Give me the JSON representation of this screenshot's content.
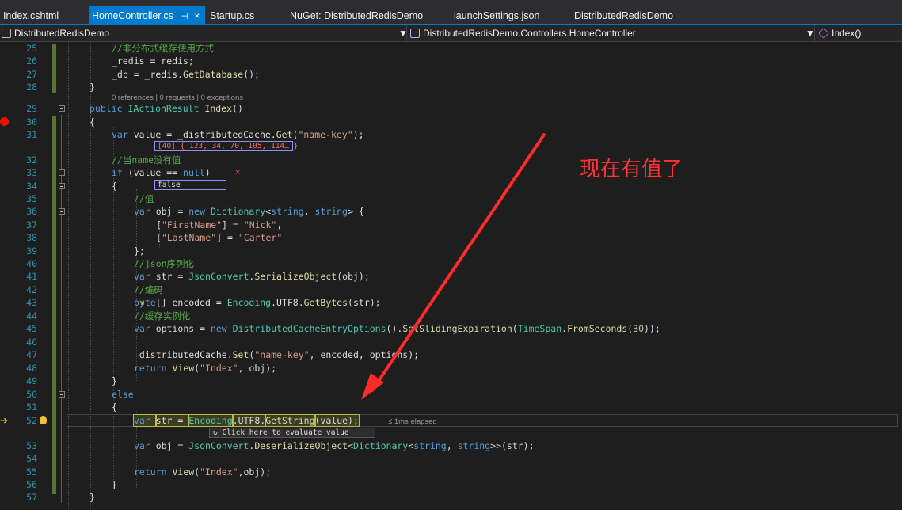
{
  "tabs": [
    {
      "label": "Index.cshtml"
    },
    {
      "label": "HomeController.cs",
      "pin": "⊣",
      "close": "×"
    },
    {
      "label": "Startup.cs"
    },
    {
      "label": "NuGet: DistributedRedisDemo"
    },
    {
      "label": "launchSettings.json"
    },
    {
      "label": "DistributedRedisDemo"
    }
  ],
  "navbar": {
    "project": "DistributedRedisDemo",
    "class": "DistributedRedisDemo.Controllers.HomeController",
    "member": "Index()"
  },
  "codelens": "0 references | 0 requests | 0 exceptions",
  "datatips": {
    "value": "[40] { 123, 34, 70, 105, 114… }",
    "condition": "false",
    "elapsed": "≤ 1ms elapsed",
    "evaluate": "Click here to evaluate value"
  },
  "annotation": "现在有值了",
  "colors": {
    "accent": "#007acc",
    "breakpoint": "#e51400",
    "arrow": "#ff2a2a"
  },
  "lines": [
    {
      "n": "25",
      "code": [
        [
          "cm",
          "//非分布式缓存使用方式"
        ]
      ]
    },
    {
      "n": "26",
      "code": [
        [
          "pl",
          "_redis = redis;"
        ]
      ]
    },
    {
      "n": "27",
      "code": [
        [
          "pl",
          "_db = _redis."
        ],
        [
          "mt",
          "GetDatabase"
        ],
        [
          "pl",
          "();"
        ]
      ]
    },
    {
      "n": "28",
      "code": [
        [
          "pl",
          "}"
        ]
      ]
    },
    {
      "n": "29",
      "code": [
        [
          "kw",
          "public "
        ],
        [
          "ty",
          "IActionResult "
        ],
        [
          "mt",
          "Index"
        ],
        [
          "pl",
          "()"
        ]
      ]
    },
    {
      "n": "30",
      "code": [
        [
          "pl",
          "{"
        ]
      ]
    },
    {
      "n": "31",
      "code": [
        [
          "kw",
          "var "
        ],
        [
          "pl",
          "value = _distributedCache."
        ],
        [
          "mt",
          "Get"
        ],
        [
          "pl",
          "("
        ],
        [
          "st",
          "\"name-key\""
        ],
        [
          "pl",
          ");"
        ]
      ]
    },
    {
      "n": "32",
      "code": [
        [
          "cm",
          "//当name没有值"
        ]
      ]
    },
    {
      "n": "33",
      "code": [
        [
          "kw",
          "if "
        ],
        [
          "pl",
          "(value == "
        ],
        [
          "kw",
          "null"
        ],
        [
          "pl",
          ")"
        ]
      ]
    },
    {
      "n": "34",
      "code": [
        [
          "pl",
          "{"
        ]
      ]
    },
    {
      "n": "35",
      "code": [
        [
          "cm",
          "//值"
        ]
      ]
    },
    {
      "n": "36",
      "code": [
        [
          "kw",
          "var "
        ],
        [
          "pl",
          "obj = "
        ],
        [
          "kw",
          "new "
        ],
        [
          "ty",
          "Dictionary"
        ],
        [
          "pl",
          "<"
        ],
        [
          "kw",
          "string"
        ],
        [
          "pl",
          ", "
        ],
        [
          "kw",
          "string"
        ],
        [
          "pl",
          "> {"
        ]
      ]
    },
    {
      "n": "37",
      "code": [
        [
          "pl",
          "["
        ],
        [
          "st",
          "\"FirstName\""
        ],
        [
          "pl",
          "] = "
        ],
        [
          "st",
          "\"Nick\""
        ],
        [
          "pl",
          ","
        ]
      ]
    },
    {
      "n": "38",
      "code": [
        [
          "pl",
          "["
        ],
        [
          "st",
          "\"LastName\""
        ],
        [
          "pl",
          "] = "
        ],
        [
          "st",
          "\"Carter\""
        ]
      ]
    },
    {
      "n": "39",
      "code": [
        [
          "pl",
          "};"
        ]
      ]
    },
    {
      "n": "40",
      "code": [
        [
          "cm",
          "//json序列化"
        ]
      ]
    },
    {
      "n": "41",
      "code": [
        [
          "kw",
          "var "
        ],
        [
          "pl",
          "str = "
        ],
        [
          "ty",
          "JsonConvert"
        ],
        [
          "pl",
          "."
        ],
        [
          "mt",
          "SerializeObject"
        ],
        [
          "pl",
          "(obj);"
        ]
      ]
    },
    {
      "n": "42",
      "code": [
        [
          "cm",
          "//编码"
        ]
      ]
    },
    {
      "n": "43",
      "code": [
        [
          "kw",
          "byte"
        ],
        [
          "pl",
          "[] encoded = "
        ],
        [
          "ty",
          "Encoding"
        ],
        [
          "pl",
          ".UTF8."
        ],
        [
          "mt",
          "GetBytes"
        ],
        [
          "pl",
          "(str);"
        ]
      ]
    },
    {
      "n": "44",
      "code": [
        [
          "cm",
          "//缓存实例化"
        ]
      ]
    },
    {
      "n": "45",
      "code": [
        [
          "kw",
          "var "
        ],
        [
          "pl",
          "options = "
        ],
        [
          "kw",
          "new "
        ],
        [
          "ty",
          "DistributedCacheEntryOptions"
        ],
        [
          "pl",
          "()."
        ],
        [
          "mt",
          "SetSlidingExpiration"
        ],
        [
          "pl",
          "("
        ],
        [
          "ty",
          "TimeSpan"
        ],
        [
          "pl",
          "."
        ],
        [
          "mt",
          "FromSeconds"
        ],
        [
          "pl",
          "("
        ],
        [
          "nu",
          "30"
        ],
        [
          "pl",
          "));"
        ]
      ]
    },
    {
      "n": "46",
      "code": []
    },
    {
      "n": "47",
      "code": [
        [
          "pl",
          "_distributedCache."
        ],
        [
          "mt",
          "Set"
        ],
        [
          "pl",
          "("
        ],
        [
          "st",
          "\"name-key\""
        ],
        [
          "pl",
          ", encoded, options);"
        ]
      ]
    },
    {
      "n": "48",
      "code": [
        [
          "kw",
          "return "
        ],
        [
          "mt",
          "View"
        ],
        [
          "pl",
          "("
        ],
        [
          "st",
          "\"Index\""
        ],
        [
          "pl",
          ", obj);"
        ]
      ]
    },
    {
      "n": "49",
      "code": [
        [
          "pl",
          "}"
        ]
      ]
    },
    {
      "n": "50",
      "code": [
        [
          "kw",
          "else"
        ]
      ]
    },
    {
      "n": "51",
      "code": [
        [
          "pl",
          "{"
        ]
      ]
    },
    {
      "n": "52",
      "code": [
        [
          "kw",
          "var "
        ],
        [
          "pl",
          "str = "
        ],
        [
          "ty",
          "Encoding"
        ],
        [
          "pl",
          ".UTF8."
        ],
        [
          "mt",
          "GetString"
        ],
        [
          "pl",
          "(value);"
        ]
      ]
    },
    {
      "n": "53",
      "code": [
        [
          "kw",
          "var "
        ],
        [
          "pl",
          "obj = "
        ],
        [
          "ty",
          "JsonConvert"
        ],
        [
          "pl",
          "."
        ],
        [
          "mt",
          "DeserializeObject"
        ],
        [
          "pl",
          "<"
        ],
        [
          "ty",
          "Dictionary"
        ],
        [
          "pl",
          "<"
        ],
        [
          "kw",
          "string"
        ],
        [
          "pl",
          ", "
        ],
        [
          "kw",
          "string"
        ],
        [
          "pl",
          ">>(str);"
        ]
      ]
    },
    {
      "n": "54",
      "code": []
    },
    {
      "n": "55",
      "code": [
        [
          "kw",
          "return "
        ],
        [
          "mt",
          "View"
        ],
        [
          "pl",
          "("
        ],
        [
          "st",
          "\"Index\""
        ],
        [
          "pl",
          ",obj);"
        ]
      ]
    },
    {
      "n": "56",
      "code": [
        [
          "pl",
          "}"
        ]
      ]
    },
    {
      "n": "57",
      "code": [
        [
          "pl",
          "}"
        ]
      ]
    }
  ]
}
